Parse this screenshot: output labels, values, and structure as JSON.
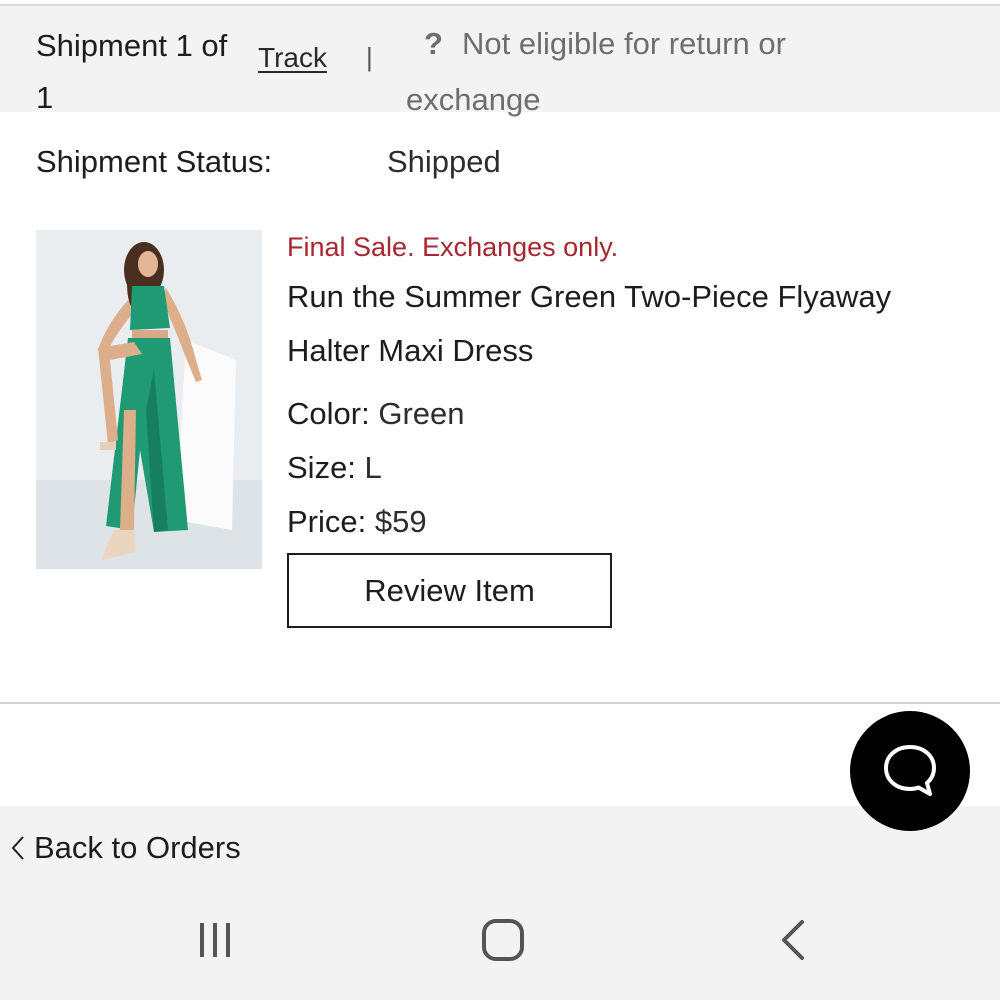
{
  "shipment": {
    "count_line1": "Shipment 1 of",
    "count_line2": "1",
    "track_label": "Track",
    "divider": "|",
    "return_icon": "?",
    "return_line1": "Not eligible for return or",
    "return_line2": "exchange"
  },
  "status": {
    "label": "Shipment Status:",
    "value": "Shipped"
  },
  "product": {
    "image_icon": "product-photo-green-dress",
    "final_sale": "Final Sale. Exchanges only.",
    "name": "Run the Summer Green Two-Piece Flyaway Halter Maxi Dress",
    "color_label": "Color:",
    "color_value": "Green",
    "size_label": "Size:",
    "size_value": "L",
    "price_label": "Price:",
    "price_value": "$59",
    "review_label": "Review Item"
  },
  "footer": {
    "back_label": "Back to Orders",
    "back_icon": "chevron-left-icon",
    "chat_icon": "chat-bubble-icon"
  },
  "system_nav": {
    "recents_icon": "recent-apps-icon",
    "home_icon": "home-icon",
    "back_icon": "back-arrow-icon"
  },
  "colors": {
    "final_sale_red": "#a8262f",
    "header_gray": "#f3f3f3",
    "chat_button_black": "#000000",
    "dress_green": "#1f9a72"
  }
}
